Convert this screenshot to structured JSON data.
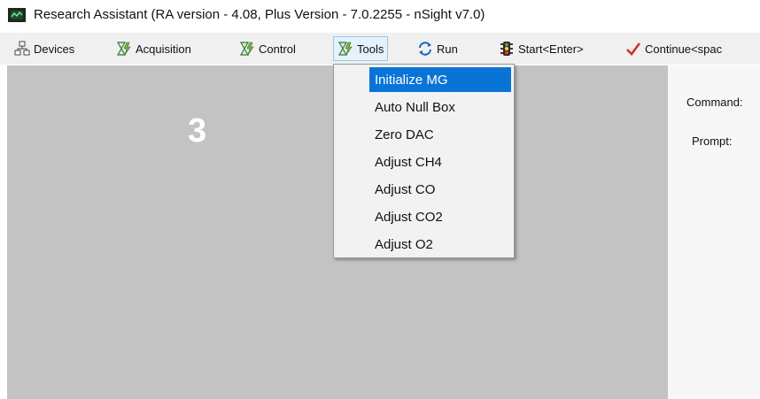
{
  "window": {
    "title": "Research Assistant (RA version - 4.08, Plus Version - 7.0.2255 - nSight v7.0)",
    "app_icon": "monitor-chart-icon"
  },
  "menubar": {
    "items": [
      {
        "label": "Devices",
        "icon": "network-icon"
      },
      {
        "label": "Acquisition",
        "icon": "hourglass-lightning-icon"
      },
      {
        "label": "Control",
        "icon": "hourglass-lightning-icon"
      },
      {
        "label": "Tools",
        "icon": "hourglass-lightning-icon",
        "open": true
      },
      {
        "label": "Run",
        "icon": "refresh-arrows-icon"
      },
      {
        "label": "Start<Enter>",
        "icon": "traffic-light-icon"
      },
      {
        "label": "Continue<spac",
        "icon": "checkmark-icon"
      }
    ]
  },
  "tools_menu": {
    "items": [
      {
        "label": "Initialize MG",
        "selected": true
      },
      {
        "label": "Auto Null Box"
      },
      {
        "label": "Zero DAC"
      },
      {
        "label": "Adjust CH4"
      },
      {
        "label": "Adjust CO"
      },
      {
        "label": "Adjust CO2"
      },
      {
        "label": "Adjust O2"
      }
    ]
  },
  "main": {
    "channel_number": "3"
  },
  "side_panel": {
    "command_label": "Command:",
    "prompt_label": "Prompt:"
  },
  "colors": {
    "selected_highlight": "#0a74d6",
    "panel_gray": "#c3c3c3",
    "menubar_bg": "#f0f0f0"
  }
}
